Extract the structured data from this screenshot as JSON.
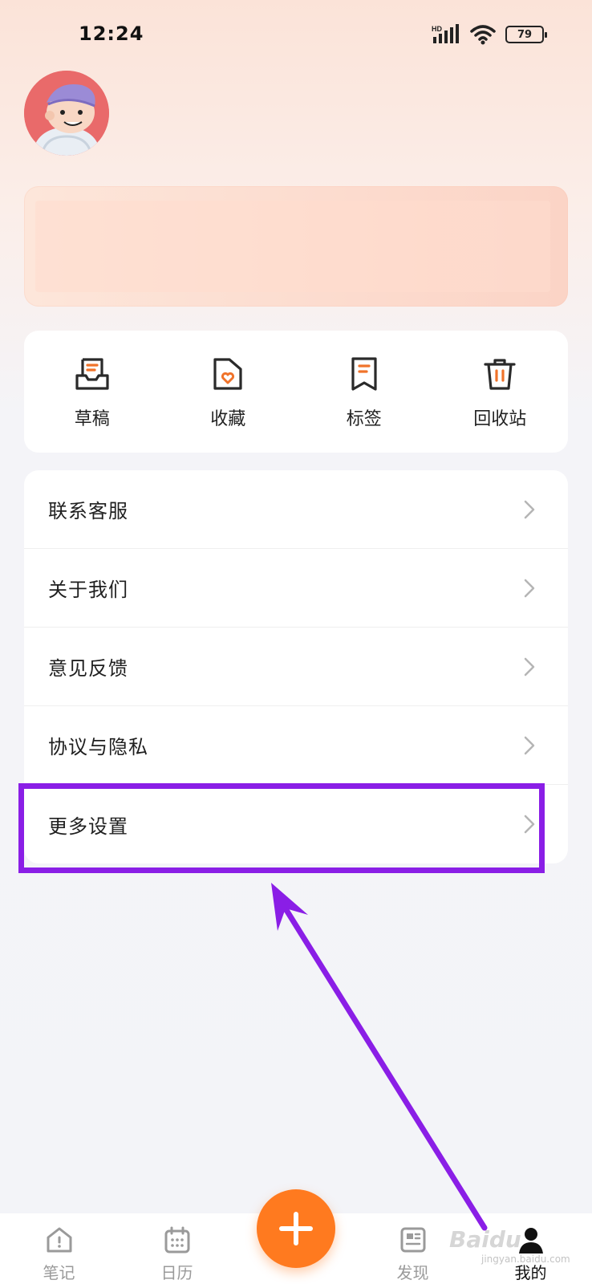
{
  "status_bar": {
    "time": "12:24",
    "network": "HD",
    "battery": "79",
    "icons": [
      "signal-icon",
      "wifi-icon",
      "battery-icon"
    ]
  },
  "profile": {
    "avatar_icon": "avatar-cartoon-icon"
  },
  "quick_actions": [
    {
      "label": "草稿",
      "icon": "draft-tray-icon"
    },
    {
      "label": "收藏",
      "icon": "folder-heart-icon"
    },
    {
      "label": "标签",
      "icon": "bookmark-icon"
    },
    {
      "label": "回收站",
      "icon": "trash-icon"
    }
  ],
  "menu": [
    {
      "label": "联系客服"
    },
    {
      "label": "关于我们"
    },
    {
      "label": "意见反馈"
    },
    {
      "label": "协议与隐私"
    },
    {
      "label": "更多设置"
    }
  ],
  "bottom_nav": [
    {
      "label": "笔记",
      "icon": "home-icon"
    },
    {
      "label": "日历",
      "icon": "calendar-icon"
    },
    {
      "label": "发现",
      "icon": "news-icon"
    },
    {
      "label": "我的",
      "icon": "person-icon",
      "active": true
    }
  ],
  "fab": {
    "icon": "plus-icon"
  },
  "watermark": {
    "text": "Baidu",
    "sub": "jingyan.baidu.com"
  },
  "colors": {
    "accent": "#ff7a1f",
    "icon_accent": "#f0732a",
    "annotation": "#8a1ee6"
  }
}
